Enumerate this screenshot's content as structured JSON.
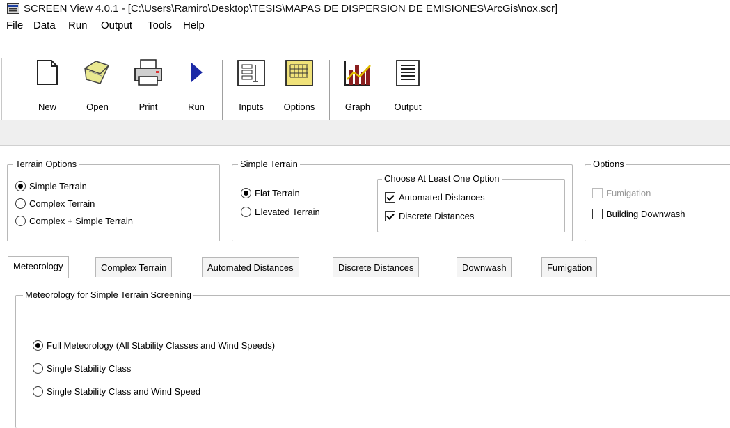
{
  "window": {
    "title": "SCREEN View 4.0.1 - [C:\\Users\\Ramiro\\Desktop\\TESIS\\MAPAS DE DISPERSION  DE EMISIONES\\ArcGis\\nox.scr]",
    "icon": "app-window-icon"
  },
  "menu": [
    "File",
    "Data",
    "Run",
    "Output",
    "Tools",
    "Help"
  ],
  "toolbar": {
    "new": "New",
    "open": "Open",
    "print": "Print",
    "run": "Run",
    "inputs": "Inputs",
    "options": "Options",
    "graph": "Graph",
    "output": "Output"
  },
  "terrain_options": {
    "title": "Terrain Options",
    "items": [
      "Simple Terrain",
      "Complex Terrain",
      "Complex + Simple Terrain"
    ],
    "selected": "Simple Terrain"
  },
  "simple_terrain": {
    "title": "Simple Terrain",
    "items": [
      "Flat Terrain",
      "Elevated Terrain"
    ],
    "selected": "Flat Terrain"
  },
  "choose_option": {
    "title": "Choose At Least One Option",
    "automated": "Automated Distances",
    "discrete": "Discrete Distances",
    "automated_checked": true,
    "discrete_checked": true
  },
  "options": {
    "title": "Options",
    "fumigation": "Fumigation",
    "building_downwash": "Building Downwash"
  },
  "tabs": [
    "Meteorology",
    "Complex Terrain",
    "Automated Distances",
    "Discrete Distances",
    "Downwash",
    "Fumigation"
  ],
  "meteorology": {
    "title": "Meteorology for Simple Terrain Screening",
    "items": [
      "Full Meteorology (All Stability Classes and Wind Speeds)",
      "Single Stability Class",
      "Single Stability Class and Wind Speed"
    ],
    "selected": "Full Meteorology (All Stability Classes and Wind Speeds)"
  }
}
